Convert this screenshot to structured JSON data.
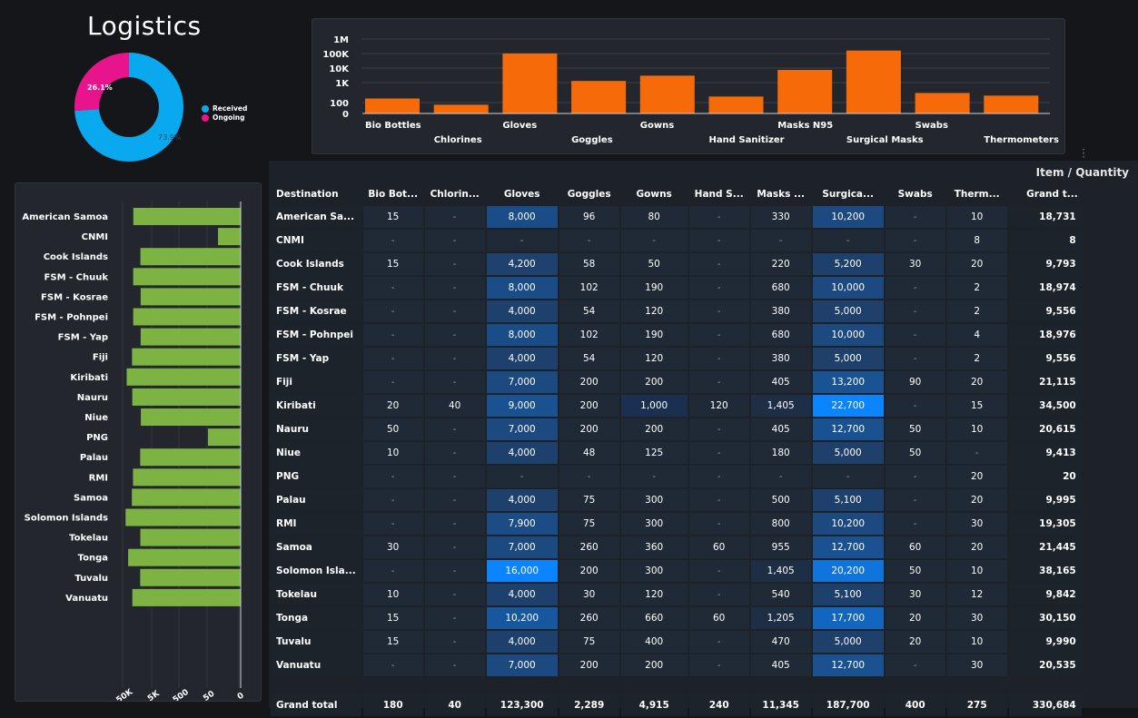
{
  "title": "Logistics",
  "donut": {
    "segments": [
      {
        "label": "Received",
        "percent": 73.9,
        "color": "#0aa8ee"
      },
      {
        "label": "Ongoing",
        "percent": 26.1,
        "color": "#e8148c"
      }
    ],
    "received_label": "73.9%",
    "ongoing_label": "26.1%"
  },
  "chart_data": [
    {
      "type": "bar",
      "scale": "log",
      "categories": [
        "Bio Bottles",
        "Chlorines",
        "Gloves",
        "Goggles",
        "Gowns",
        "Hand Sanitizer",
        "Masks N95",
        "Surgical Masks",
        "Swabs",
        "Thermometers"
      ],
      "values": [
        180,
        40,
        123300,
        2289,
        4915,
        240,
        11345,
        187700,
        400,
        275
      ],
      "ytick_labels": [
        "1M",
        "100K",
        "10K",
        "1K",
        "100",
        "0"
      ],
      "color": "#f76a0a"
    },
    {
      "type": "bar",
      "orientation": "horizontal",
      "scale": "log",
      "direction": "reversed",
      "categories": [
        "American Samoa",
        "CNMI",
        "Cook Islands",
        "FSM - Chuuk",
        "FSM - Kosrae",
        "FSM - Pohnpei",
        "FSM - Yap",
        "Fiji",
        "Kiribati",
        "Nauru",
        "Niue",
        "PNG",
        "Palau",
        "RMI",
        "Samoa",
        "Solomon Islands",
        "Tokelau",
        "Tonga",
        "Tuvalu",
        "Vanuatu"
      ],
      "values": [
        18731,
        8,
        9793,
        18974,
        9556,
        18976,
        9556,
        21115,
        34500,
        20615,
        9413,
        20,
        9995,
        19305,
        21445,
        38165,
        9842,
        30150,
        9990,
        20535
      ],
      "xtick_labels": [
        "50K",
        "5K",
        "500",
        "50",
        "0"
      ],
      "color": "#7db342"
    }
  ],
  "table": {
    "title": "Item / Quantity",
    "headers": [
      "Destination",
      "Bio Bot...",
      "Chlorin...",
      "Gloves",
      "Goggles",
      "Gowns",
      "Hand S...",
      "Masks ...",
      "Surgica...",
      "Swabs",
      "Therm...",
      "Grand t..."
    ],
    "rows": [
      [
        "American Sa...",
        "15",
        "-",
        "8,000",
        "96",
        "80",
        "-",
        "330",
        "10,200",
        "-",
        "10",
        "18,731"
      ],
      [
        "CNMI",
        "-",
        "-",
        "-",
        "-",
        "-",
        "-",
        "-",
        "-",
        "-",
        "8",
        "8"
      ],
      [
        "Cook Islands",
        "15",
        "-",
        "4,200",
        "58",
        "50",
        "-",
        "220",
        "5,200",
        "30",
        "20",
        "9,793"
      ],
      [
        "FSM - Chuuk",
        "-",
        "-",
        "8,000",
        "102",
        "190",
        "-",
        "680",
        "10,000",
        "-",
        "2",
        "18,974"
      ],
      [
        "FSM - Kosrae",
        "-",
        "-",
        "4,000",
        "54",
        "120",
        "-",
        "380",
        "5,000",
        "-",
        "2",
        "9,556"
      ],
      [
        "FSM - Pohnpei",
        "-",
        "-",
        "8,000",
        "102",
        "190",
        "-",
        "680",
        "10,000",
        "-",
        "4",
        "18,976"
      ],
      [
        "FSM - Yap",
        "-",
        "-",
        "4,000",
        "54",
        "120",
        "-",
        "380",
        "5,000",
        "-",
        "2",
        "9,556"
      ],
      [
        "Fiji",
        "-",
        "-",
        "7,000",
        "200",
        "200",
        "-",
        "405",
        "13,200",
        "90",
        "20",
        "21,115"
      ],
      [
        "Kiribati",
        "20",
        "40",
        "9,000",
        "200",
        "1,000",
        "120",
        "1,405",
        "22,700",
        "-",
        "15",
        "34,500"
      ],
      [
        "Nauru",
        "50",
        "-",
        "7,000",
        "200",
        "200",
        "-",
        "405",
        "12,700",
        "50",
        "10",
        "20,615"
      ],
      [
        "Niue",
        "10",
        "-",
        "4,000",
        "48",
        "125",
        "-",
        "180",
        "5,000",
        "50",
        "-",
        "9,413"
      ],
      [
        "PNG",
        "-",
        "-",
        "-",
        "-",
        "-",
        "-",
        "-",
        "-",
        "-",
        "20",
        "20"
      ],
      [
        "Palau",
        "-",
        "-",
        "4,000",
        "75",
        "300",
        "-",
        "500",
        "5,100",
        "-",
        "20",
        "9,995"
      ],
      [
        "RMI",
        "-",
        "-",
        "7,900",
        "75",
        "300",
        "-",
        "800",
        "10,200",
        "-",
        "30",
        "19,305"
      ],
      [
        "Samoa",
        "30",
        "-",
        "7,000",
        "260",
        "360",
        "60",
        "955",
        "12,700",
        "60",
        "20",
        "21,445"
      ],
      [
        "Solomon Isla...",
        "-",
        "-",
        "16,000",
        "200",
        "300",
        "-",
        "1,405",
        "20,200",
        "50",
        "10",
        "38,165"
      ],
      [
        "Tokelau",
        "10",
        "-",
        "4,000",
        "30",
        "120",
        "-",
        "540",
        "5,100",
        "30",
        "12",
        "9,842"
      ],
      [
        "Tonga",
        "15",
        "-",
        "10,200",
        "260",
        "660",
        "60",
        "1,205",
        "17,700",
        "20",
        "30",
        "30,150"
      ],
      [
        "Tuvalu",
        "15",
        "-",
        "4,000",
        "75",
        "400",
        "-",
        "470",
        "5,000",
        "20",
        "10",
        "9,990"
      ],
      [
        "Vanuatu",
        "-",
        "-",
        "7,000",
        "200",
        "200",
        "-",
        "405",
        "12,700",
        "-",
        "30",
        "20,535"
      ]
    ],
    "grand_total": [
      "Grand total",
      "180",
      "40",
      "123,300",
      "2,289",
      "4,915",
      "240",
      "11,345",
      "187,700",
      "400",
      "275",
      "330,684"
    ]
  },
  "colors": {
    "background": "#141619",
    "panel": "#23272d",
    "cell": "#202a36",
    "heat_low": "#1f3d66",
    "heat_high": "#0a84ff"
  },
  "icons": {
    "more": "vertical-dots-icon"
  }
}
